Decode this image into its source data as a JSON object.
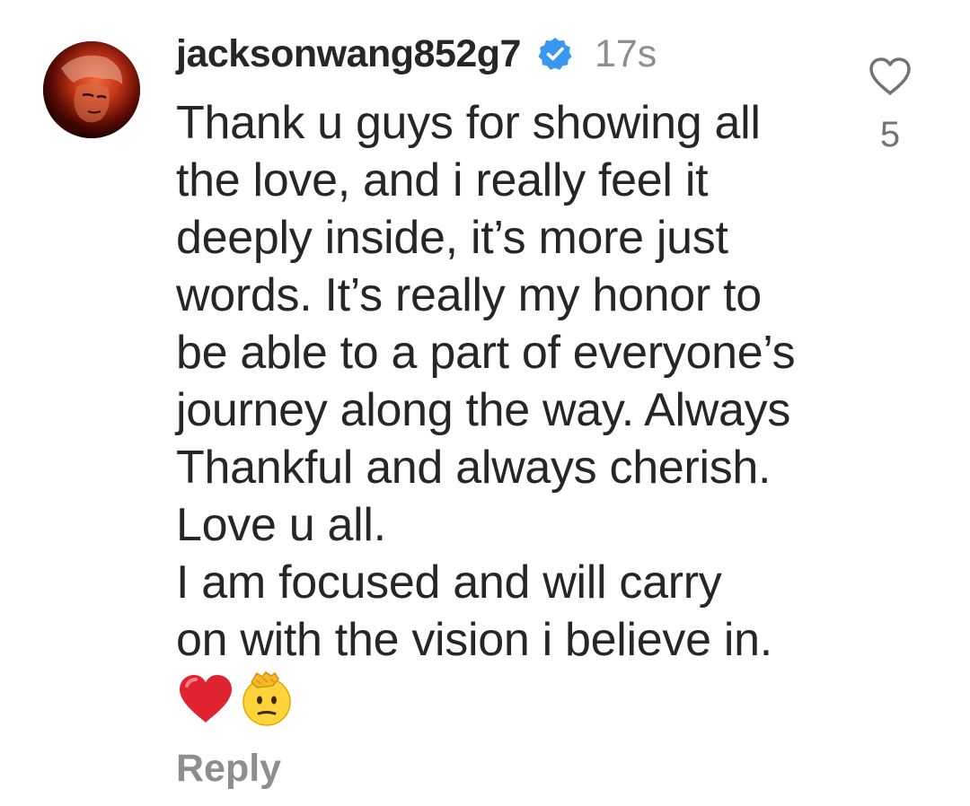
{
  "comment": {
    "username": "jacksonwang852g7",
    "verified_icon": "verified-badge-icon",
    "timestamp": "17s",
    "text": "Thank u guys for showing all\nthe love, and i really feel it\ndeeply inside, it’s more just\nwords. It’s really my honor to\nbe able to a part of everyone’s\njourney along the way. Always\nThankful and always cherish.\nLove u all.\nI am focused and will carry\non with the vision i believe in.",
    "emojis": [
      "red-heart-emoji",
      "saluting-face-emoji"
    ],
    "reply_label": "Reply",
    "like_icon": "heart-outline-icon",
    "like_count": "5"
  },
  "colors": {
    "text": "#262626",
    "muted": "#8e8e8e",
    "verified": "#3897f0"
  }
}
